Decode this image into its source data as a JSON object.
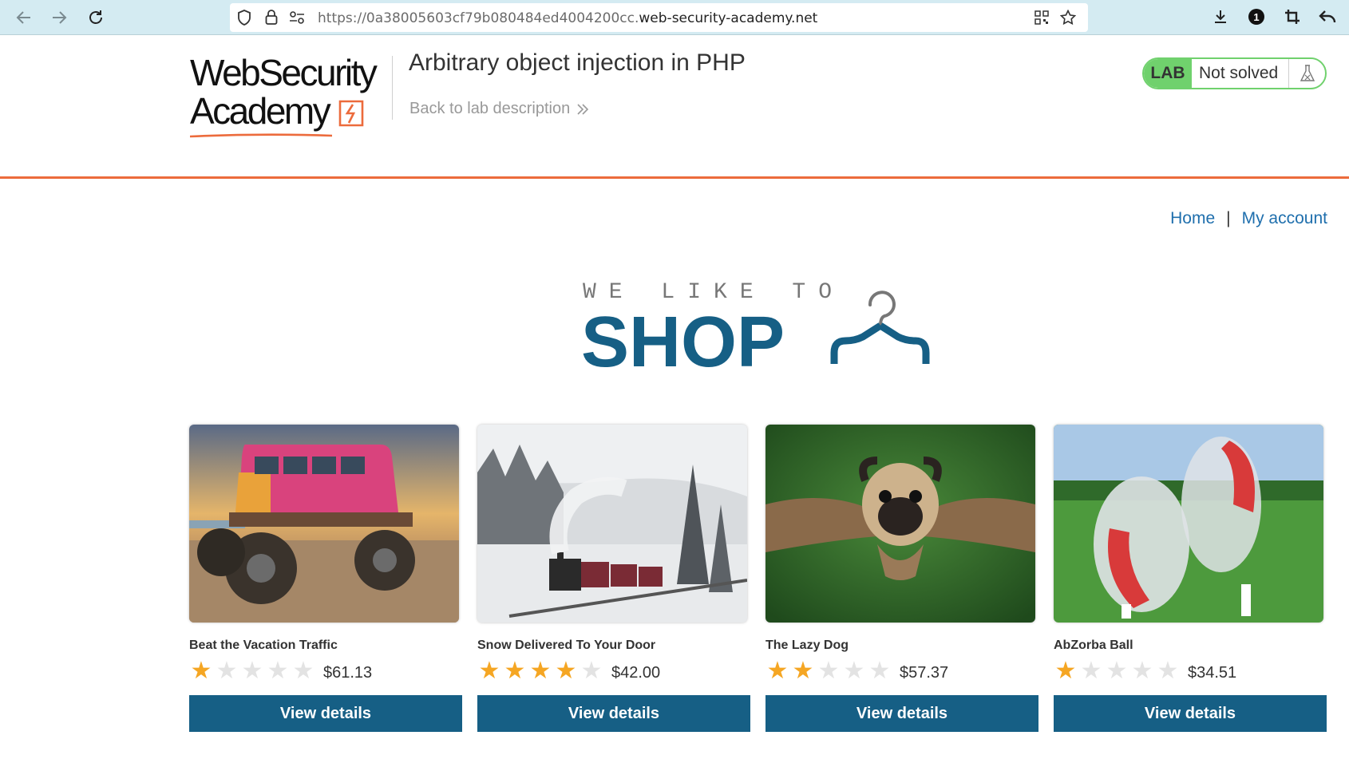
{
  "browser": {
    "url_prefix": "https://0a38005603cf79b080484ed4004200cc.",
    "url_domain": "web-security-academy.net",
    "extension_badge": "1"
  },
  "academy": {
    "logo_line1": "WebSecurity",
    "logo_line2": "Academy",
    "lab_title": "Arbitrary object injection in PHP",
    "back_link": "Back to lab description",
    "lab_tag": "LAB",
    "lab_status": "Not solved",
    "accent_color": "#ec6b3c",
    "solved_color": "#70d16d"
  },
  "nav": {
    "home": "Home",
    "separator": "|",
    "my_account": "My account"
  },
  "banner": {
    "top_text": "WE LIKE TO",
    "main_text": "SHOP"
  },
  "products": [
    {
      "name": "Beat the Vacation Traffic",
      "rating": 1,
      "price": "$61.13",
      "button": "View details"
    },
    {
      "name": "Snow Delivered To Your Door",
      "rating": 4,
      "price": "$42.00",
      "button": "View details"
    },
    {
      "name": "The Lazy Dog",
      "rating": 2,
      "price": "$57.37",
      "button": "View details"
    },
    {
      "name": "AbZorba Ball",
      "rating": 1,
      "price": "$34.51",
      "button": "View details"
    }
  ]
}
